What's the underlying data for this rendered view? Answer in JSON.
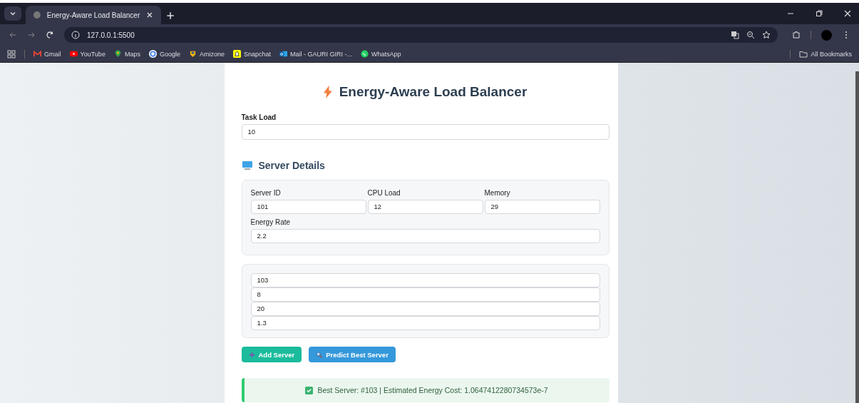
{
  "browser": {
    "tab": {
      "title": "Energy-Aware Load Balancer",
      "selected": true
    },
    "url": "127.0.0.1:5500",
    "bookmarks": [
      {
        "label": "Gmail",
        "kind": "gmail"
      },
      {
        "label": "YouTube",
        "kind": "youtube"
      },
      {
        "label": "Maps",
        "kind": "maps"
      },
      {
        "label": "Google",
        "kind": "google"
      },
      {
        "label": "Amizone",
        "kind": "amizone"
      },
      {
        "label": "Snapchat",
        "kind": "snapchat"
      },
      {
        "label": "Mail - GAURI GIRI -...",
        "kind": "mail"
      },
      {
        "label": "WhatsApp",
        "kind": "whatsapp"
      }
    ],
    "all_bookmarks": "All Bookmarks"
  },
  "page": {
    "title": "Energy-Aware Load Balancer",
    "task_load": {
      "label": "Task Load",
      "value": "10"
    },
    "section_title": "Server Details",
    "servers": [
      {
        "fields": [
          {
            "label": "Server ID",
            "value": "101"
          },
          {
            "label": "CPU Load",
            "value": "12"
          },
          {
            "label": "Memory",
            "value": "29"
          },
          {
            "label": "Energy Rate",
            "value": "2.2"
          }
        ]
      },
      {
        "fields": [
          {
            "value": "103"
          },
          {
            "value": "8"
          },
          {
            "value": "20"
          },
          {
            "value": "1.3"
          }
        ]
      }
    ],
    "buttons": [
      {
        "label": "Add Server",
        "kind": "add"
      },
      {
        "label": "Predict Best Server",
        "kind": "predict"
      }
    ],
    "result": "Best Server: #103 | Estimated Energy Cost: 1.0647412280734573e-7"
  }
}
